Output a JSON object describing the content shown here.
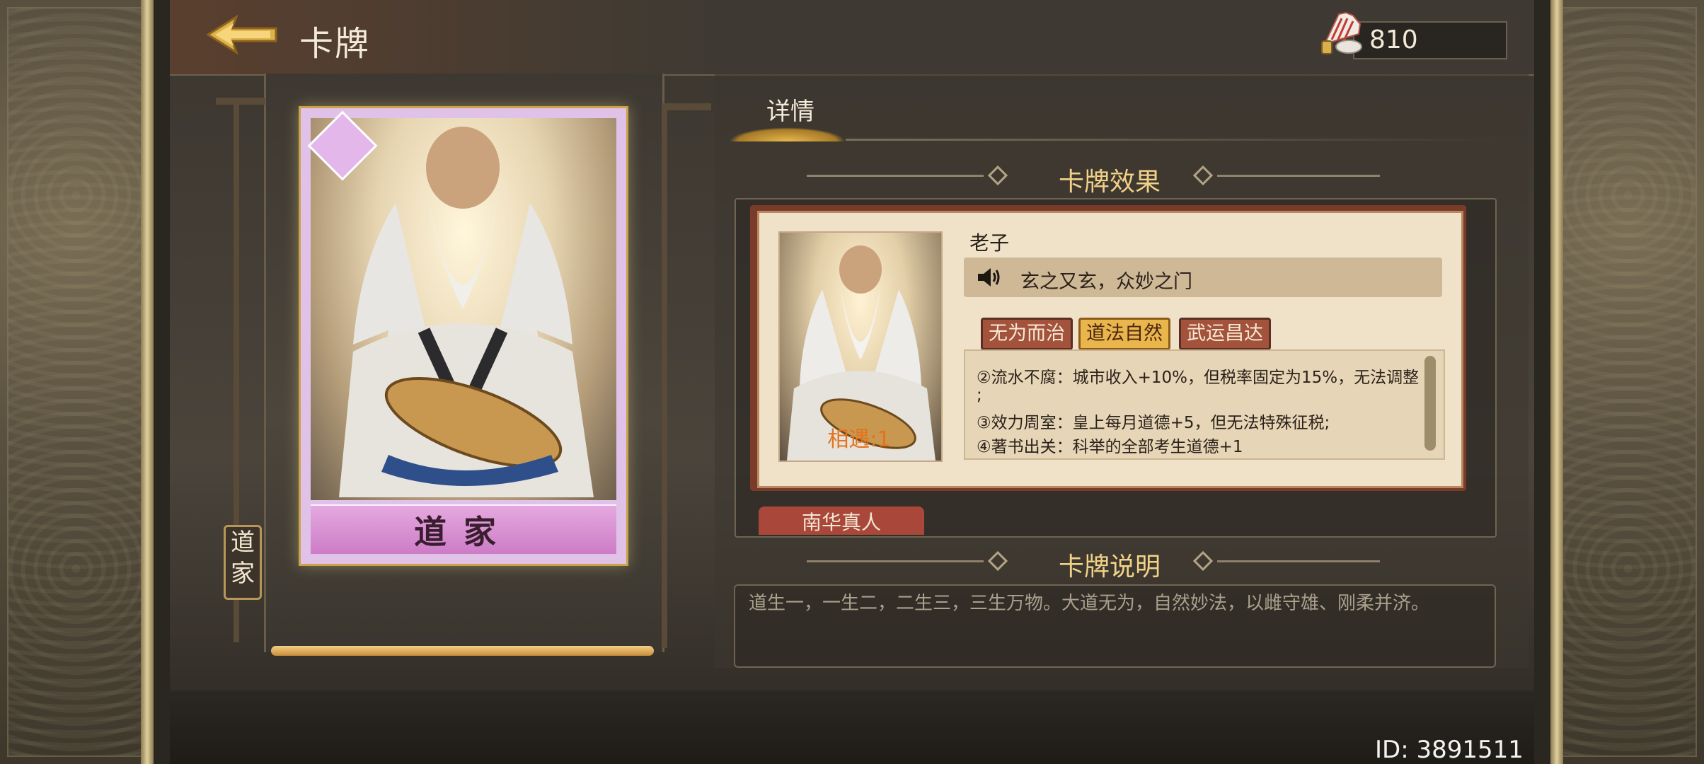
{
  "header": {
    "title": "卡牌",
    "currency_value": "810"
  },
  "card": {
    "school_name": "道家",
    "vertical_tag": "道家",
    "progress": 1.0
  },
  "details": {
    "tab_label": "详情",
    "effect_heading": "卡牌效果",
    "character": {
      "name": "老子",
      "quote": "玄之又玄，众妙之门",
      "encounter": "相遇:1"
    },
    "skill_tabs": [
      {
        "label": "无为而治",
        "active": false
      },
      {
        "label": "道法自然",
        "active": true
      },
      {
        "label": "武运昌达",
        "active": false
      }
    ],
    "effect_lines": [
      "②流水不腐：城市收入+10%，但税率固定为15%，无法调整",
      ";",
      "③效力周室：皇上每月道德+5，但无法特殊征税;",
      "④著书出关：科举的全部考生道德+1"
    ],
    "next_card_tab": "南华真人",
    "description_heading": "卡牌说明",
    "description": "道生一，一生二，二生三，三生万物。大道无为，自然妙法，以雌守雄、刚柔并济。"
  },
  "footer": {
    "id_label": "ID: 3891511"
  },
  "colors": {
    "accent_gold": "#f2d287",
    "active_tab": "#e8b64a",
    "inactive_tab": "#a3533c",
    "encounter": "#e3731d"
  },
  "icons": [
    "back-arrow-icon",
    "currency-fan-icon",
    "speaker-icon",
    "card-badge-icon"
  ]
}
